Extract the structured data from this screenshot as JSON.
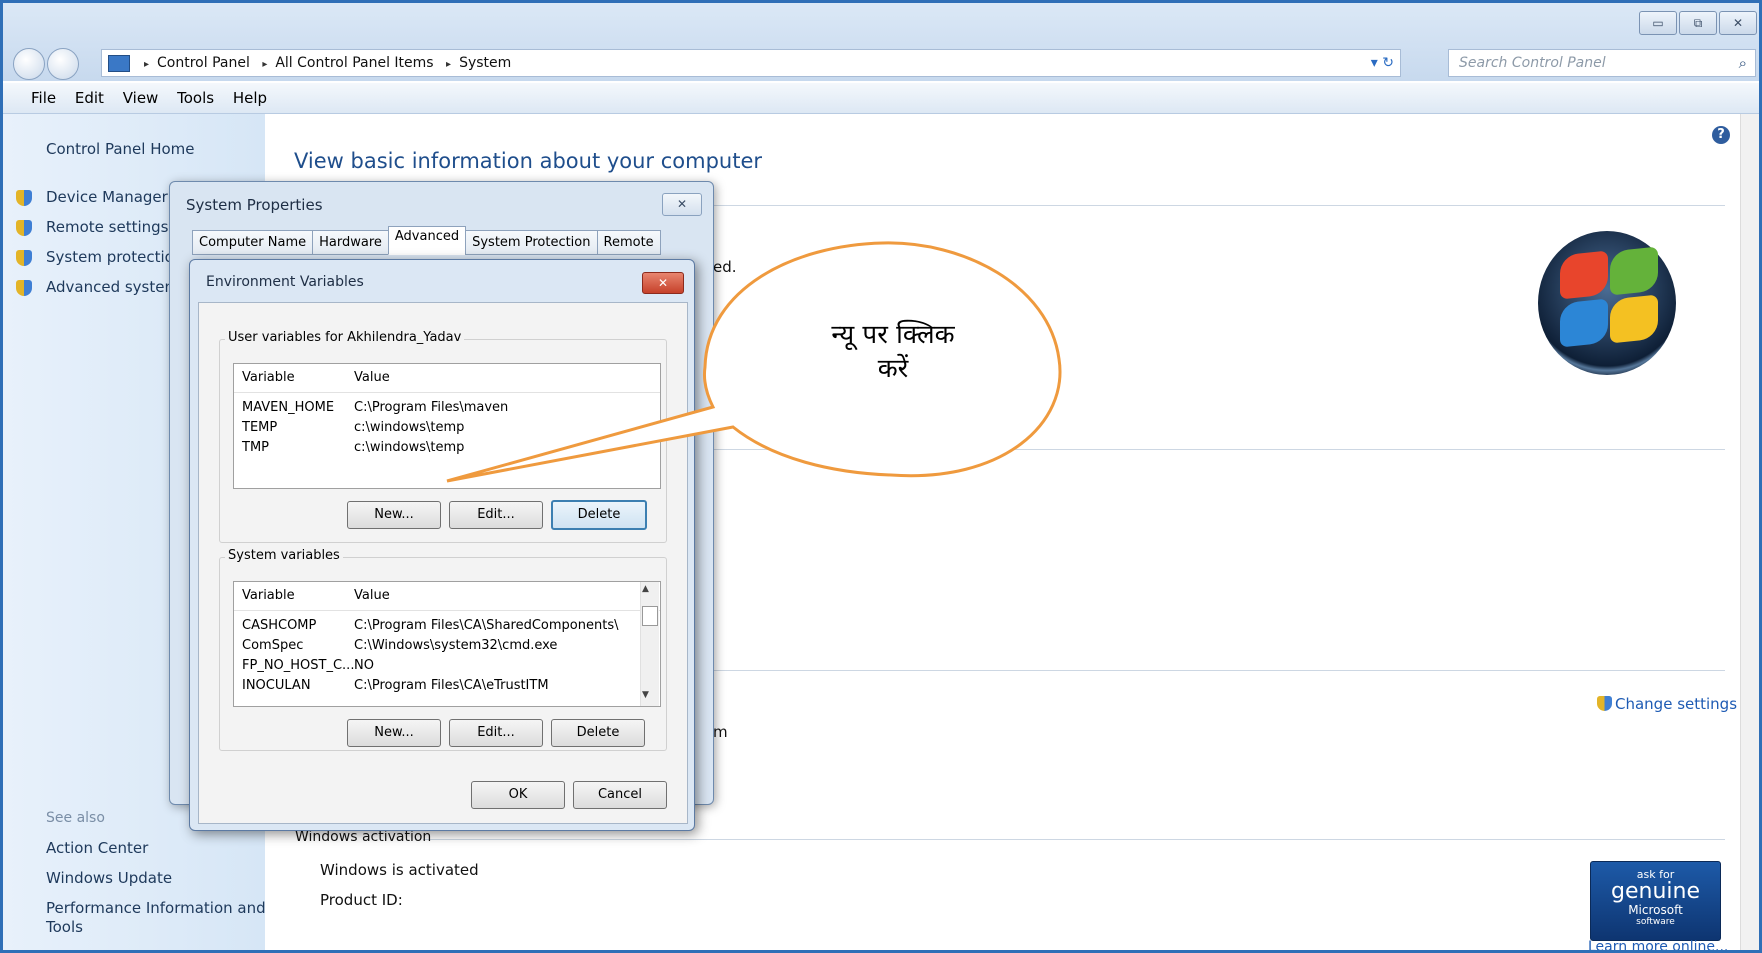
{
  "window": {
    "address": {
      "crumbs": [
        "Control Panel",
        "All Control Panel Items",
        "System"
      ],
      "separator": "▸",
      "refresh_glyph": "▾ ↻"
    },
    "search_placeholder": "Search Control Panel",
    "controls": [
      "▭",
      "⧉",
      "✕"
    ],
    "icons": [
      "back-icon",
      "forward-icon",
      "computer-icon",
      "refresh-icon",
      "search-icon"
    ]
  },
  "menubar": [
    "File",
    "Edit",
    "View",
    "Tools",
    "Help"
  ],
  "leftpane": {
    "home": "Control Panel Home",
    "links": [
      "Device Manager",
      "Remote settings",
      "System protection",
      "Advanced system"
    ],
    "see_also": "See also",
    "see_also_links": [
      "Action Center",
      "Windows Update",
      "Performance Information and",
      "Tools"
    ]
  },
  "main": {
    "title": "View basic information about your computer",
    "partial_text_1": "ed.",
    "partial_text_2": "m",
    "change_settings": "Change settings",
    "activation_heading": "Windows activation",
    "activated": "Windows is activated",
    "product_id": "Product ID:",
    "genuine": {
      "top": "ask for",
      "brand": "genuine",
      "company": "Microsoft",
      "sub": "software"
    },
    "learn_more": "Learn more online...",
    "help_glyph": "?"
  },
  "system_properties": {
    "title": "System Properties",
    "close": "✕",
    "tabs": [
      "Computer Name",
      "Hardware",
      "Advanced",
      "System Protection",
      "Remote"
    ],
    "active_tab": "Advanced"
  },
  "env_vars": {
    "title": "Environment Variables",
    "close": "✕",
    "user_group": "User variables for Akhilendra_Yadav",
    "col_variable": "Variable",
    "col_value": "Value",
    "user_rows": [
      {
        "variable": "MAVEN_HOME",
        "value": "C:\\Program Files\\maven"
      },
      {
        "variable": "TEMP",
        "value": "c:\\windows\\temp"
      },
      {
        "variable": "TMP",
        "value": "c:\\windows\\temp"
      }
    ],
    "system_group": "System variables",
    "system_rows": [
      {
        "variable": "CASHCOMP",
        "value": "C:\\Program Files\\CA\\SharedComponents\\"
      },
      {
        "variable": "ComSpec",
        "value": "C:\\Windows\\system32\\cmd.exe"
      },
      {
        "variable": "FP_NO_HOST_C...",
        "value": "NO"
      },
      {
        "variable": "INOCULAN",
        "value": "C:\\Program Files\\CA\\eTrustITM"
      }
    ],
    "buttons": {
      "new": "New...",
      "edit": "Edit...",
      "delete": "Delete",
      "ok": "OK",
      "cancel": "Cancel"
    }
  },
  "callout": {
    "line1": "न्यू पर क्लिक",
    "line2": "करें",
    "color": "#ef9a3e"
  }
}
